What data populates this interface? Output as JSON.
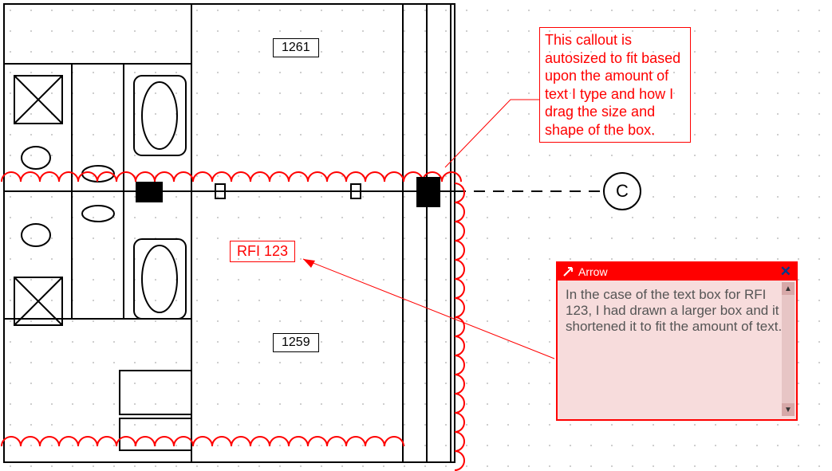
{
  "rooms": {
    "upper": "1261",
    "lower": "1259"
  },
  "grid_label_right": "C",
  "callouts": {
    "autosize": {
      "text": "This callout is autosized to fit based upon the amount of text I type and how I drag the size and shape of the box."
    },
    "rfi": {
      "text": "RFI 123"
    }
  },
  "tooltip": {
    "title": "Arrow",
    "close_glyph": "✕",
    "body": "In the case of the text box for RFI 123, I had drawn a larger box and it shortened it to fit the amount of text.",
    "scroll_up": "▲",
    "scroll_down": "▼"
  },
  "colors": {
    "accent": "#ff0000"
  }
}
